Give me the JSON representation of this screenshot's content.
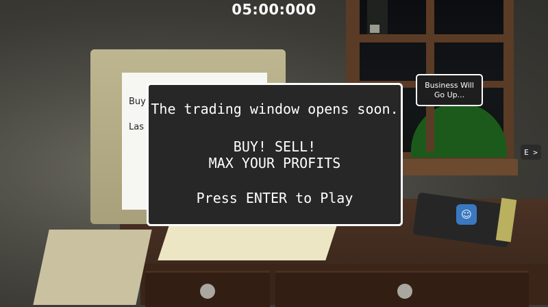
{
  "hud": {
    "timer": "05:00:000"
  },
  "dialog": {
    "line1": "The trading window opens soon.",
    "line2": "BUY! SELL!",
    "line3": "MAX YOUR PROFITS",
    "line4": "Press ENTER to Play"
  },
  "tooltip": {
    "text": "Business Will Go Up..."
  },
  "side_button": {
    "label": "E >"
  },
  "monitor_screen": {
    "text1": "Buyi",
    "text2": "Las"
  },
  "notebook_logo": {
    "icon": "godot-robot-icon",
    "glyph": "☺"
  },
  "colors": {
    "dialog_bg": "#272727",
    "dialog_border": "#ffffff",
    "text": "#ffffff"
  }
}
